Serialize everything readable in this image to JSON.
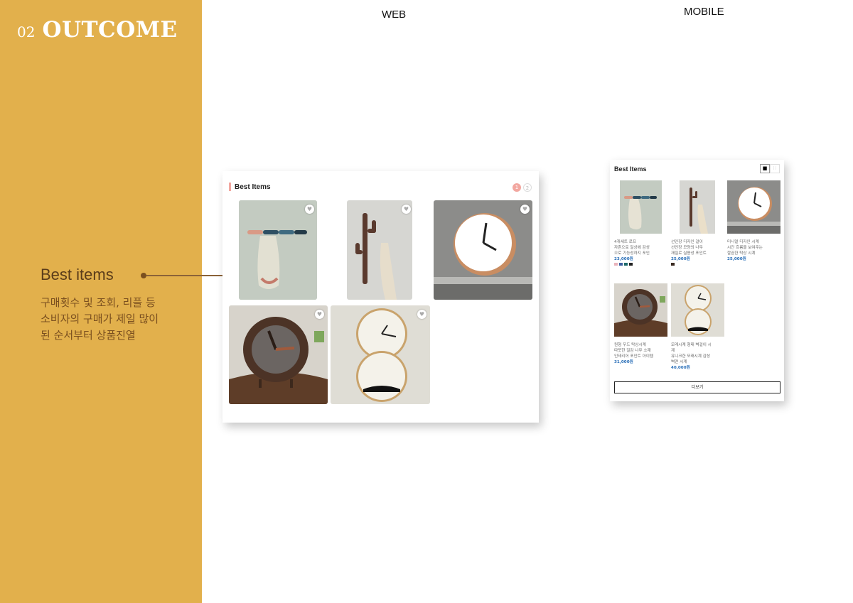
{
  "section": {
    "number": "02",
    "title": "OUTCOME",
    "feature_label": "Best items",
    "feature_desc": "구매횟수 및 조회, 리플 등\n소비자의 구매가 제일 많이\n된 순서부터 상품진열"
  },
  "columns": {
    "web": "WEB",
    "mobile": "MOBILE"
  },
  "web": {
    "title": "Best Items",
    "pager": [
      "1",
      "2"
    ],
    "products": [
      {
        "icon": "wall-hook-image"
      },
      {
        "icon": "cactus-hook-image"
      },
      {
        "icon": "round-clock-image"
      },
      {
        "icon": "wood-clock-image"
      },
      {
        "icon": "hourglass-clock-image"
      }
    ]
  },
  "mobile": {
    "title": "Best Items",
    "view_toggle": [
      "grid-view-icon",
      "list-view-icon"
    ],
    "more_label": "더보기",
    "products": [
      {
        "name": "4개세트 로프\n자흔으로 일상에 감성\n으로 기능성까지 포인",
        "price": "23,000원",
        "swatches": [
          "#e9b3bb",
          "#3c5fa0",
          "#1e6a6a",
          "#222222"
        ]
      },
      {
        "name": "선인장 디자인 걸이\n선인장 모양의 나무\n재질로 실용성 포인트",
        "price": "25,000원",
        "swatches": [
          "#3a2a22"
        ]
      },
      {
        "name": "미니멀 디자인 시계\n시간 흐름을 보여주는\n깔끔한 탁상 시계",
        "price": "25,000원",
        "swatches": []
      },
      {
        "name": "원형 우드 탁상시계\n따뜻한 질감 나무 소재\n인테리어 포인트 아이템",
        "price": "31,000원",
        "swatches": []
      },
      {
        "name": "모래시계 형태 벽걸이 시\n계\n유니크한 모래시계 감성\n벽면 시계",
        "price": "40,000원",
        "swatches": []
      }
    ]
  }
}
